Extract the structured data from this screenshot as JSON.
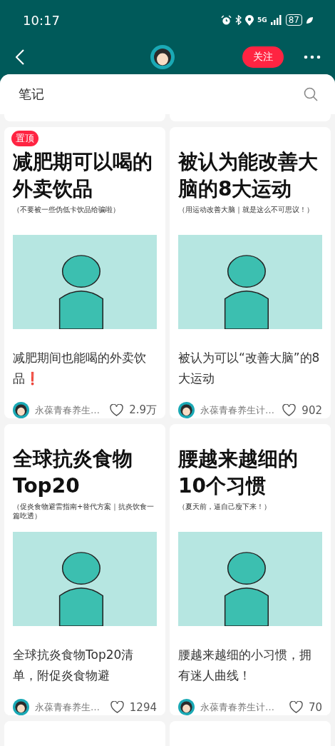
{
  "status_bar": {
    "time": "10:17",
    "network": "5G",
    "battery": "87"
  },
  "header": {
    "follow_button": "关注"
  },
  "tab": {
    "label": "笔记"
  },
  "notes": [
    {
      "pinned": true,
      "pin_label": "置顶",
      "cover_title": "减肥期可以喝的外卖饮品",
      "cover_subtitle": "（不要被一些伪低卡饮品给骗啦）",
      "caption": "减肥期间也能喝的外卖饮品❗",
      "author": "永葆青春养生…",
      "likes": "2.9万"
    },
    {
      "pinned": false,
      "cover_title": "被认为能改善大脑的8大运动",
      "cover_subtitle": "（用运动改善大脑｜就是这么不可思议！）",
      "caption": "被认为可以“改善大脑”的8大运动",
      "author": "永葆青春养生计…",
      "likes": "902"
    },
    {
      "pinned": false,
      "cover_title": "全球抗炎食物Top20",
      "cover_subtitle": "（促炎食物避雷指南+替代方案｜抗炎饮食一篇吃透）",
      "caption": "全球抗炎食物Top20清单，附促炎食物避",
      "author": "永葆青春养生…",
      "likes": "1294"
    },
    {
      "pinned": false,
      "cover_title": "腰越来越细的10个习惯",
      "cover_subtitle": "（夏天前，逼自己瘦下来！）",
      "caption": "腰越来越细的小习惯，拥有迷人曲线！",
      "author": "永葆青春养生计…",
      "likes": "70"
    }
  ]
}
